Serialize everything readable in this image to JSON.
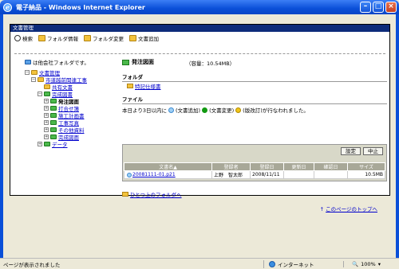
{
  "window": {
    "title": "電子納品 - Windows Internet Explorer"
  },
  "app": {
    "header": "文書管理"
  },
  "toolbar": {
    "search": "検索",
    "folder_info": "フォルダ情報",
    "folder_change": "フォルダ変更",
    "doc_add": "文書追加"
  },
  "tree": {
    "root_note": "は他会社フォルダです。",
    "doc_mgmt": "文書管理",
    "project": "市道越前関連工事",
    "shared": "共有文書",
    "completion": "完成図書",
    "ordered": "発注図面",
    "meeting": "打合せ簿",
    "plan": "施工計画書",
    "photo": "工事写真",
    "other": "その他資料",
    "completion_dwg": "完成図面",
    "data": "データ"
  },
  "content": {
    "title": "発注図面",
    "capacity": "（容量：10.54MB）",
    "folder_section": "フォルダ",
    "subfolder": "特記仕様書",
    "file_section": "ファイル",
    "legend_prefix": "本日より3日以内に",
    "legend_add": "(文書追加)",
    "legend_change": "(文書変更)",
    "legend_rev": "(版改訂)が行なわれました。",
    "btn_setting": "設定",
    "btn_stop": "中止",
    "columns": [
      "文書名▲",
      "登録者",
      "登録日",
      "更新日",
      "確認日",
      "サイズ"
    ],
    "rows": [
      {
        "name": "20081111-01.p21",
        "owner": "上野　智太郎",
        "reg": "2008/11/11",
        "upd": "",
        "chk": "",
        "size": "10.5MB"
      }
    ],
    "up_link": "ひとつ上のフォルダへ",
    "top_link": "このページのトップへ"
  },
  "status": {
    "text": "ページが表示されました",
    "zone": "インターネット",
    "zoom": "100%"
  },
  "colors": {
    "titlebar": "#0a4fd8",
    "app_header": "#0d2b7a",
    "link": "#0000cc"
  }
}
